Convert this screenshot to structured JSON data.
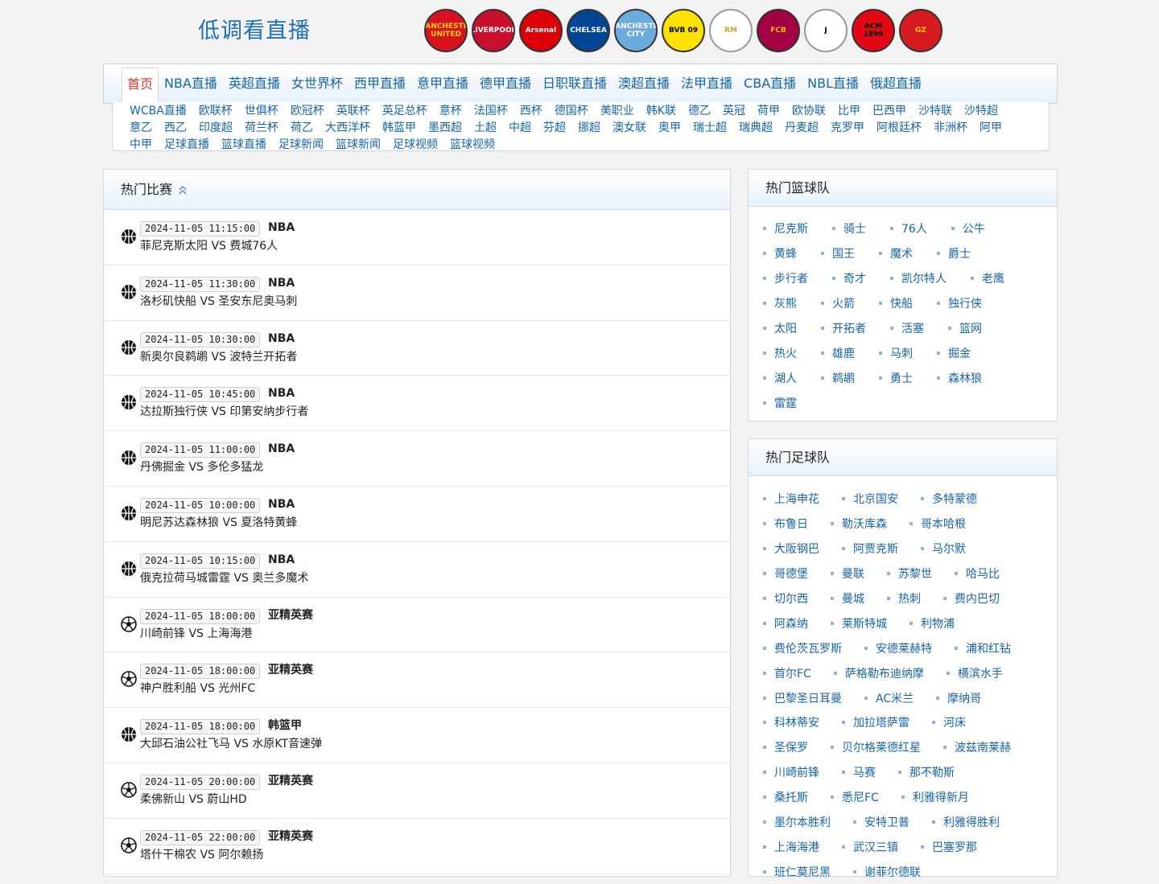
{
  "site": {
    "title": "低调看直播"
  },
  "club_logos": [
    {
      "icon": "manchester-united-logo",
      "text": "MANCHESTER UNITED",
      "bg": "#d8131f",
      "fg": "#f7d117"
    },
    {
      "icon": "liverpool-logo",
      "text": "LIVERPOOL",
      "bg": "#c8102e",
      "fg": "#ffffff"
    },
    {
      "icon": "arsenal-logo",
      "text": "Arsenal",
      "bg": "#db0007",
      "fg": "#ffffff"
    },
    {
      "icon": "chelsea-logo",
      "text": "CHELSEA",
      "bg": "#034694",
      "fg": "#ffffff"
    },
    {
      "icon": "manchester-city-logo",
      "text": "MANCHESTER CITY",
      "bg": "#6cabdd",
      "fg": "#ffffff"
    },
    {
      "icon": "dortmund-logo",
      "text": "BVB 09",
      "bg": "#fde100",
      "fg": "#000000"
    },
    {
      "icon": "real-madrid-logo",
      "text": "RM",
      "bg": "#ffffff",
      "fg": "#cda434"
    },
    {
      "icon": "barcelona-logo",
      "text": "FCB",
      "bg": "#a50044",
      "fg": "#edbb00"
    },
    {
      "icon": "juventus-logo",
      "text": "J",
      "bg": "#ffffff",
      "fg": "#000000"
    },
    {
      "icon": "ac-milan-logo",
      "text": "ACM 1899",
      "bg": "#e30613",
      "fg": "#000000"
    },
    {
      "icon": "guangzhou-logo",
      "text": "GZ",
      "bg": "#d71920",
      "fg": "#f5c800"
    }
  ],
  "nav": {
    "main": [
      "首页",
      "NBA直播",
      "英超直播",
      "女世界杯",
      "西甲直播",
      "意甲直播",
      "德甲直播",
      "日职联直播",
      "澳超直播",
      "法甲直播",
      "CBA直播",
      "NBL直播",
      "俄超直播"
    ],
    "sub": [
      "WCBA直播",
      "欧联杯",
      "世俱杯",
      "欧冠杯",
      "英联杯",
      "英足总杯",
      "意杯",
      "法国杯",
      "西杯",
      "德国杯",
      "美职业",
      "韩K联",
      "德乙",
      "英冠",
      "荷甲",
      "欧协联",
      "比甲",
      "巴西甲",
      "沙特联",
      "沙特超",
      "意乙",
      "西乙",
      "印度超",
      "荷兰杯",
      "荷乙",
      "大西洋杯",
      "韩蓝甲",
      "墨西超",
      "土超",
      "中超",
      "芬超",
      "挪超",
      "澳女联",
      "奥甲",
      "瑞士超",
      "瑞典超",
      "丹麦超",
      "克罗甲",
      "阿根廷杯",
      "非洲杯",
      "阿甲",
      "中甲",
      "足球直播",
      "篮球直播",
      "足球新闻",
      "篮球新闻",
      "足球视频",
      "篮球视频"
    ]
  },
  "hot_matches": {
    "title": "热门比赛",
    "items": [
      {
        "sport": "basketball",
        "time": "2024-11-05 11:15:00",
        "league": "NBA",
        "teams": "菲尼克斯太阳 VS 费城76人"
      },
      {
        "sport": "basketball",
        "time": "2024-11-05 11:30:00",
        "league": "NBA",
        "teams": "洛杉矶快船 VS 圣安东尼奥马刺"
      },
      {
        "sport": "basketball",
        "time": "2024-11-05 10:30:00",
        "league": "NBA",
        "teams": "新奥尔良鹈鹕 VS 波特兰开拓者"
      },
      {
        "sport": "basketball",
        "time": "2024-11-05 10:45:00",
        "league": "NBA",
        "teams": "达拉斯独行侠 VS 印第安纳步行者"
      },
      {
        "sport": "basketball",
        "time": "2024-11-05 11:00:00",
        "league": "NBA",
        "teams": "丹佛掘金 VS 多伦多猛龙"
      },
      {
        "sport": "basketball",
        "time": "2024-11-05 10:00:00",
        "league": "NBA",
        "teams": "明尼苏达森林狼 VS 夏洛特黄蜂"
      },
      {
        "sport": "basketball",
        "time": "2024-11-05 10:15:00",
        "league": "NBA",
        "teams": "俄克拉荷马城雷霆 VS 奥兰多魔术"
      },
      {
        "sport": "football",
        "time": "2024-11-05 18:00:00",
        "league": "亚精英赛",
        "teams": "川崎前锋 VS 上海海港"
      },
      {
        "sport": "football",
        "time": "2024-11-05 18:00:00",
        "league": "亚精英赛",
        "teams": "神户胜利船 VS 光州FC"
      },
      {
        "sport": "basketball",
        "time": "2024-11-05 18:00:00",
        "league": "韩篮甲",
        "teams": "大邱石油公社飞马 VS 水原KT音速弹"
      },
      {
        "sport": "football",
        "time": "2024-11-05 20:00:00",
        "league": "亚精英赛",
        "teams": "柔佛新山 VS 蔚山HD"
      },
      {
        "sport": "football",
        "time": "2024-11-05 22:00:00",
        "league": "亚精英赛",
        "teams": "塔什干棉农 VS 阿尔赖扬"
      }
    ]
  },
  "hot_basketball": {
    "title": "热门篮球队",
    "rows": [
      [
        "尼克斯",
        "骑士",
        "76人",
        "公牛"
      ],
      [
        "黄蜂",
        "国王",
        "魔术",
        "爵士"
      ],
      [
        "步行者",
        "奇才",
        "凯尔特人",
        "老鹰"
      ],
      [
        "灰熊",
        "火箭",
        "快船",
        "独行侠"
      ],
      [
        "太阳",
        "开拓者",
        "活塞",
        "篮网"
      ],
      [
        "热火",
        "雄鹿",
        "马刺",
        "掘金"
      ],
      [
        "湖人",
        "鹈鹕",
        "勇士",
        "森林狼"
      ],
      [
        "雷霆"
      ]
    ]
  },
  "hot_football": {
    "title": "热门足球队",
    "rows": [
      [
        "上海申花",
        "北京国安",
        "多特蒙德"
      ],
      [
        "布鲁日",
        "勒沃库森",
        "哥本哈根"
      ],
      [
        "大阪钢巴",
        "阿贾克斯",
        "马尔默"
      ],
      [
        "哥德堡",
        "曼联",
        "苏黎世",
        "哈马比"
      ],
      [
        "切尔西",
        "曼城",
        "热刺",
        "费内巴切"
      ],
      [
        "阿森纳",
        "莱斯特城",
        "利物浦"
      ],
      [
        "费伦茨瓦罗斯",
        "安德莱赫特",
        "浦和红钻"
      ],
      [
        "首尔FC",
        "萨格勒布迪纳摩",
        "横滨水手"
      ],
      [
        "巴黎圣日耳曼",
        "AC米兰",
        "摩纳哥"
      ],
      [
        "科林蒂安",
        "加拉塔萨雷",
        "河床"
      ],
      [
        "圣保罗",
        "贝尔格莱德红星",
        "波兹南莱赫"
      ],
      [
        "川崎前锋",
        "马赛",
        "那不勒斯"
      ],
      [
        "桑托斯",
        "悉尼FC",
        "利雅得新月"
      ],
      [
        "墨尔本胜利",
        "安特卫普",
        "利雅得胜利"
      ],
      [
        "上海海港",
        "武汉三镇",
        "巴塞罗那"
      ],
      [
        "班仁莫尼黑",
        "谢菲尔德联"
      ]
    ]
  }
}
